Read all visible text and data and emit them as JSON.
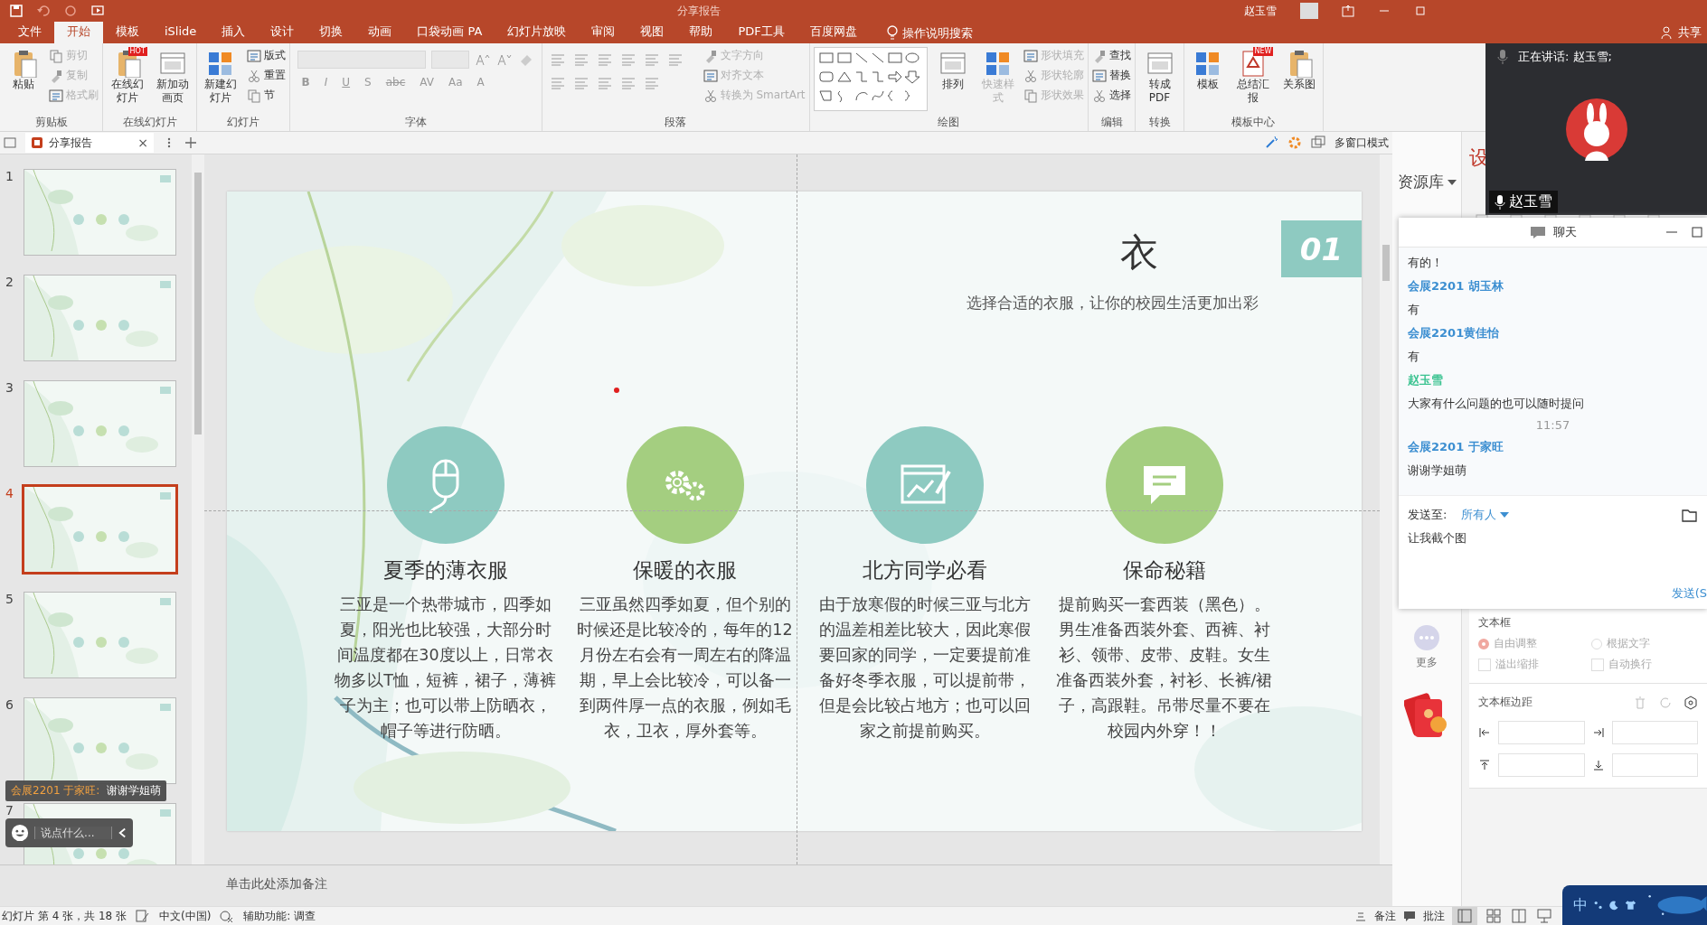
{
  "title_bar": {
    "title": "分享报告",
    "user": "赵玉雪"
  },
  "tabs": [
    {
      "label": "文件",
      "selected": false
    },
    {
      "label": "开始",
      "selected": true
    },
    {
      "label": "模板",
      "selected": false
    },
    {
      "label": "iSlide",
      "selected": false
    },
    {
      "label": "插入",
      "selected": false
    },
    {
      "label": "设计",
      "selected": false
    },
    {
      "label": "切换",
      "selected": false
    },
    {
      "label": "动画",
      "selected": false
    },
    {
      "label": "口袋动画 PA",
      "selected": false
    },
    {
      "label": "幻灯片放映",
      "selected": false
    },
    {
      "label": "审阅",
      "selected": false
    },
    {
      "label": "视图",
      "selected": false
    },
    {
      "label": "帮助",
      "selected": false
    },
    {
      "label": "PDF工具",
      "selected": false
    },
    {
      "label": "百度网盘",
      "selected": false
    }
  ],
  "tell_me": "操作说明搜索",
  "share": "共享",
  "ribbon": {
    "groups": [
      {
        "label": "剪贴板",
        "items": [
          {
            "kind": "large",
            "label": "粘贴",
            "disabled": false
          },
          {
            "kind": "small",
            "label": "剪切",
            "disabled": true
          },
          {
            "kind": "small",
            "label": "复制",
            "disabled": true
          },
          {
            "kind": "small",
            "label": "格式刷",
            "disabled": true
          }
        ]
      },
      {
        "label": "在线幻灯片",
        "items": [
          {
            "kind": "large",
            "label": "在线幻灯片",
            "badge": "HOT",
            "disabled": false
          },
          {
            "kind": "large",
            "label": "新加动画页",
            "disabled": false
          }
        ]
      },
      {
        "label": "幻灯片",
        "items": [
          {
            "kind": "large",
            "label": "新建幻灯片",
            "disabled": false
          },
          {
            "kind": "small",
            "label": "版式",
            "disabled": false
          },
          {
            "kind": "small",
            "label": "重置",
            "disabled": false
          },
          {
            "kind": "small",
            "label": "节",
            "disabled": false
          }
        ]
      },
      {
        "label": "字体",
        "items": [
          {
            "kind": "font",
            "buttons": [
              "B",
              "I",
              "U",
              "S",
              "abc",
              "AV",
              "Aa",
              "A"
            ]
          }
        ]
      },
      {
        "label": "段落",
        "items": [
          {
            "kind": "paragraph"
          },
          {
            "kind": "small",
            "label": "文字方向",
            "disabled": true
          },
          {
            "kind": "small",
            "label": "对齐文本",
            "disabled": true
          },
          {
            "kind": "small",
            "label": "转换为 SmartArt",
            "disabled": true
          }
        ]
      },
      {
        "label": "绘图",
        "items": [
          {
            "kind": "shapes"
          },
          {
            "kind": "large",
            "label": "排列",
            "disabled": false
          },
          {
            "kind": "large",
            "label": "快速样式",
            "disabled": true
          },
          {
            "kind": "small",
            "label": "形状填充",
            "disabled": true
          },
          {
            "kind": "small",
            "label": "形状轮廓",
            "disabled": true
          },
          {
            "kind": "small",
            "label": "形状效果",
            "disabled": true
          }
        ]
      },
      {
        "label": "编辑",
        "items": [
          {
            "kind": "small",
            "label": "查找",
            "disabled": false
          },
          {
            "kind": "small",
            "label": "替换",
            "disabled": false
          },
          {
            "kind": "small",
            "label": "选择",
            "disabled": false
          }
        ]
      },
      {
        "label": "转换",
        "items": [
          {
            "kind": "large",
            "label": "转成PDF",
            "disabled": false
          }
        ]
      },
      {
        "label": "模板中心",
        "items": [
          {
            "kind": "large",
            "label": "模板",
            "disabled": false
          },
          {
            "kind": "large",
            "label": "总结汇报",
            "badge": "NEW",
            "disabled": false
          },
          {
            "kind": "large",
            "label": "关系图",
            "disabled": false
          }
        ]
      }
    ]
  },
  "doc_tab": {
    "title": "分享报告",
    "close": "×",
    "multi_window": "多窗口模式"
  },
  "slides": [
    {
      "number": "1",
      "selected": false
    },
    {
      "number": "2",
      "selected": false
    },
    {
      "number": "3",
      "selected": false
    },
    {
      "number": "4",
      "selected": true
    },
    {
      "number": "5",
      "selected": false
    },
    {
      "number": "6",
      "selected": false
    },
    {
      "number": "7",
      "selected": false
    }
  ],
  "slide": {
    "number": "01",
    "heading": "衣",
    "subtitle": "选择合适的衣服，让你的校园生活更加出彩",
    "sections": [
      {
        "title": "夏季的薄衣服",
        "color": "#8ecac1",
        "body": "三亚是一个热带城市，四季如夏，阳光也比较强，大部分时间温度都在30度以上，日常衣物多以T恤，短裤，裙子，薄裤子为主；也可以带上防晒衣，帽子等进行防晒。"
      },
      {
        "title": "保暖的衣服",
        "color": "#a4ce80",
        "body": "三亚虽然四季如夏，但个别的时候还是比较冷的，每年的12月份左右会有一周左右的降温期，早上会比较冷，可以备一到两件厚一点的衣服，例如毛衣，卫衣，厚外套等。"
      },
      {
        "title": "北方同学必看",
        "color": "#8ecac1",
        "body": "由于放寒假的时候三亚与北方的温差相差比较大，因此寒假要回家的同学，一定要提前准备好冬季衣服，可以提前带，但是会比较占地方；也可以回家之前提前购买。"
      },
      {
        "title": "保命秘籍",
        "color": "#a4ce80",
        "body": "提前购买一套西装（黑色）。男生准备西装外套、西裤、衬衫、领带、皮带、皮鞋。女生准备西装外套，衬衫、长裤/裙子，高跟鞋。吊带尽量不要在校园内外穿！！"
      }
    ]
  },
  "notes_placeholder": "单击此处添加备注",
  "float_chat": {
    "sender": "会展2201 于家旺:",
    "message": "谢谢学姐萌",
    "placeholder": "说点什么..."
  },
  "meeting": {
    "speaking": "正在讲话: 赵玉雪;",
    "participant": "赵玉雪"
  },
  "chat": {
    "title": "聊天",
    "messages": [
      {
        "kind": "text",
        "text": "有的！"
      },
      {
        "kind": "sender",
        "text": "会展2201  胡玉林",
        "color": "#3d8fd1"
      },
      {
        "kind": "text",
        "text": "有"
      },
      {
        "kind": "sender",
        "text": "会展2201黄佳怡",
        "color": "#3d8fd1"
      },
      {
        "kind": "text",
        "text": "有"
      },
      {
        "kind": "sender",
        "text": "赵玉雪",
        "color": "#3cc391"
      },
      {
        "kind": "text",
        "text": "大家有什么问题的也可以随时提问"
      },
      {
        "kind": "time",
        "text": "11:57"
      },
      {
        "kind": "sender",
        "text": "会展2201 于家旺",
        "color": "#3d8fd1"
      },
      {
        "kind": "text",
        "text": "谢谢学姐萌"
      }
    ],
    "send_to_label": "发送至:",
    "send_to": "所有人",
    "draft": "让我截个图",
    "send": "发送(S"
  },
  "resources": {
    "title": "资源库",
    "more": "更多"
  },
  "format_pane": {
    "title": "设",
    "textbox": "文本框",
    "options": [
      {
        "kind": "radio",
        "label": "自由调整",
        "selected": true
      },
      {
        "kind": "radio",
        "label": "根据文字",
        "selected": false
      },
      {
        "kind": "checkbox",
        "label": "溢出缩排",
        "checked": false
      },
      {
        "kind": "checkbox",
        "label": "自动换行",
        "checked": false
      }
    ],
    "margins": "文本框边距"
  },
  "status_bar": {
    "slide_info": "幻灯片 第 4 张，共 18 张",
    "language": "中文(中国)",
    "accessibility": "辅助功能: 调查",
    "notes": "备注",
    "comments": "批注",
    "ime": "中"
  }
}
